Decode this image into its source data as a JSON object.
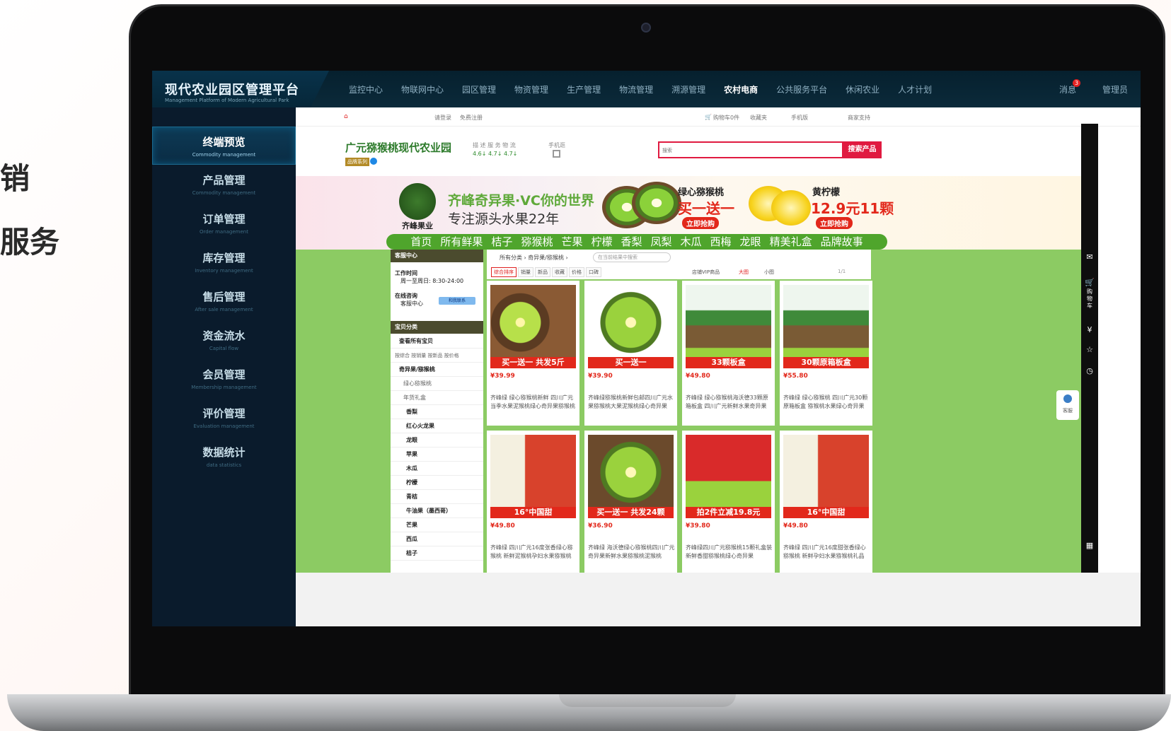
{
  "left_text": [
    "销",
    "服务"
  ],
  "topnav": {
    "brand_title": "现代农业园区管理平台",
    "brand_sub": "Management Platform of Modern Agricultural Park",
    "items": [
      "监控中心",
      "物联网中心",
      "园区管理",
      "物资管理",
      "生产管理",
      "物流管理",
      "溯源管理",
      "农村电商",
      "公共服务平台",
      "休闲农业",
      "人才计划"
    ],
    "active_index": 7,
    "messages_label": "消息",
    "messages_count": "3",
    "admin_label": "管理员"
  },
  "sidebar": {
    "items": [
      {
        "label": "终端预览",
        "sub": "Commodity management",
        "active": true
      },
      {
        "label": "产品管理",
        "sub": "Commodity management"
      },
      {
        "label": "订单管理",
        "sub": "Order management"
      },
      {
        "label": "库存管理",
        "sub": "Inventory management"
      },
      {
        "label": "售后管理",
        "sub": "After sale management"
      },
      {
        "label": "资金流水",
        "sub": "Capital flow"
      },
      {
        "label": "会员管理",
        "sub": "Membership management"
      },
      {
        "label": "评价管理",
        "sub": "Evaluation management"
      },
      {
        "label": "数据统计",
        "sub": "data statistics"
      }
    ]
  },
  "shop": {
    "topbar": {
      "login": "请登录",
      "register": "免费注册",
      "cart": "购物车0件",
      "favorite": "收藏夹",
      "mobile": "手机版",
      "seller": "商家支持"
    },
    "name": "广元猕猴桃现代农业园",
    "tag": "品牌系列",
    "rating_labels": "描 述 服 务 物 流",
    "rating_values": "4.6↓ 4.7↓ 4.7↓",
    "phone_label": "手机逛",
    "search_placeholder": "搜索",
    "search_btn": "搜索产品"
  },
  "banner": {
    "logo_text": "齐峰果业",
    "line1": "齐峰奇异果·VC你的世界",
    "line2": "专注源头水果22年",
    "kiwi_title": "绿心猕猴桃",
    "kiwi_deal": "买一送一",
    "kiwi_btn": "立即抢购",
    "lemon_title": "黄柠檬",
    "lemon_deal": "12.9元11颗",
    "lemon_btn": "立即抢购",
    "cats": [
      "首页",
      "所有鲜果",
      "桔子",
      "猕猴桃",
      "芒果",
      "柠檬",
      "香梨",
      "凤梨",
      "木瓜",
      "西梅",
      "龙眼",
      "精美礼盒",
      "品牌故事"
    ]
  },
  "left_panel": {
    "service_title": "客服中心",
    "work_time_label": "工作时间",
    "work_time": "周一至周日: 8:30-24:00",
    "online_label": "在线咨询",
    "online_name": "客服中心",
    "online_btn": "和我联系",
    "cat_title": "宝贝分类",
    "cat_all": "查看所有宝贝",
    "cat_sort": "按综合 按销量 按新品 按价格",
    "cat_group": "奇异果/猕猴桃",
    "cat_sub": [
      "绿心猕猴桃",
      "年货礼盒"
    ],
    "cats": [
      "香梨",
      "红心火龙果",
      "龙眼",
      "苹果",
      "木瓜",
      "柠檬",
      "青桔",
      "牛油果（墨西哥）",
      "芒果",
      "西瓜",
      "桔子"
    ]
  },
  "grid": {
    "bc_all": "所有分类",
    "bc_cur": "奇异果/猕猴桃",
    "search_placeholder": "在当前结果中搜索",
    "sorts": [
      "综合排序",
      "销量",
      "新品",
      "收藏",
      "价格",
      "口碑"
    ],
    "vip": "店铺VIP商品",
    "big": "大图",
    "small": "小图",
    "page": "1/1",
    "products": [
      {
        "band": "买一送一 共发5斤",
        "price": "¥39.99",
        "desc": "齐峰绿 绿心猕猴桃新鲜 四川广元当季水果泥猴桃绿心奇异果猕猴桃"
      },
      {
        "band": "买一送一",
        "price": "¥39.90",
        "desc": "齐峰绿猕猴桃新鲜包邮四川广元水果猕猴桃大果泥猴桃绿心奇异果"
      },
      {
        "band": "33颗板盒",
        "price": "¥49.80",
        "desc": "齐峰绿 绿心猕猴桃海沃德33颗原箱板盒 四川广元新鲜水果奇异果"
      },
      {
        "band": "30颗原箱板盒",
        "price": "¥55.80",
        "desc": "齐峰绿 绿心猕猴桃 四川广元30颗原箱板盒 猕猴桃水果绿心奇异果"
      },
      {
        "band": "16°中国甜",
        "price": "¥49.80",
        "desc": "齐峰绿 四川广元16度张香绿心猕猴桃 新鲜泥猴桃孕妇水果猕猴桃"
      },
      {
        "band": "买一送一 共发24颗",
        "price": "¥36.90",
        "desc": "齐峰绿 海沃德绿心猕猴桃四川广元 奇异果新鲜水果猕猴桃泥猴桃"
      },
      {
        "band": "拍2件立减19.8元",
        "price": "¥39.80",
        "desc": "齐峰绿四川广元猕猴桃15颗礼盒装 新鲜香甜猕猴桃绿心奇异果"
      },
      {
        "band": "16°中国甜",
        "price": "¥49.80",
        "desc": "齐峰绿 四川广元16度甜张香绿心猕猴桃 新鲜孕妇水果猕猴桃礼品"
      }
    ]
  },
  "right_strip": {
    "cart_label": "购物车",
    "kefu": "客服"
  }
}
